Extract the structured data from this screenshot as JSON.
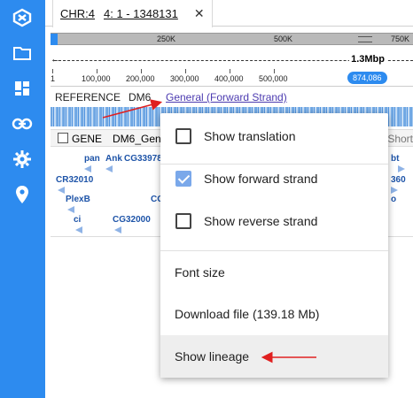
{
  "tab": {
    "chromosome": "CHR:4",
    "range": "4: 1 - 1348131",
    "close": "✕"
  },
  "overview": {
    "ticks": [
      "250K",
      "500K",
      "750K"
    ]
  },
  "scale": {
    "span_label": "1.3Mbp",
    "left_arrow": "←"
  },
  "ruler": {
    "ticks": [
      "1",
      "100,000",
      "200,000",
      "300,000",
      "400,000",
      "500,000"
    ],
    "position_badge": "874,086"
  },
  "reference": {
    "label": "REFERENCE",
    "assembly": "DM6",
    "link": "General (Forward Strand)"
  },
  "gene_track": {
    "label": "GENE",
    "name": "DM6_Gen",
    "right_label": "Short"
  },
  "genes": [
    "pan",
    "Ank",
    "CG33978",
    "CR32010",
    "PlexB",
    "ci",
    "CG32000",
    "CG",
    "bt",
    "360",
    "o"
  ],
  "menu": {
    "items": [
      {
        "label": "Show translation",
        "checked": false
      },
      {
        "label": "Show forward strand",
        "checked": true
      },
      {
        "label": "Show reverse strand",
        "checked": false
      },
      {
        "label": "Font size"
      },
      {
        "label": "Download file (139.18 Mb)"
      },
      {
        "label": "Show lineage"
      }
    ]
  },
  "colors": {
    "rail": "#2d8bef",
    "accent": "#2d8bef",
    "annotation_arrow": "#e02020"
  },
  "icons": [
    "app-logo-icon",
    "folder-icon",
    "dashboard-icon",
    "link-icon",
    "gear-icon",
    "location-pin-icon"
  ]
}
